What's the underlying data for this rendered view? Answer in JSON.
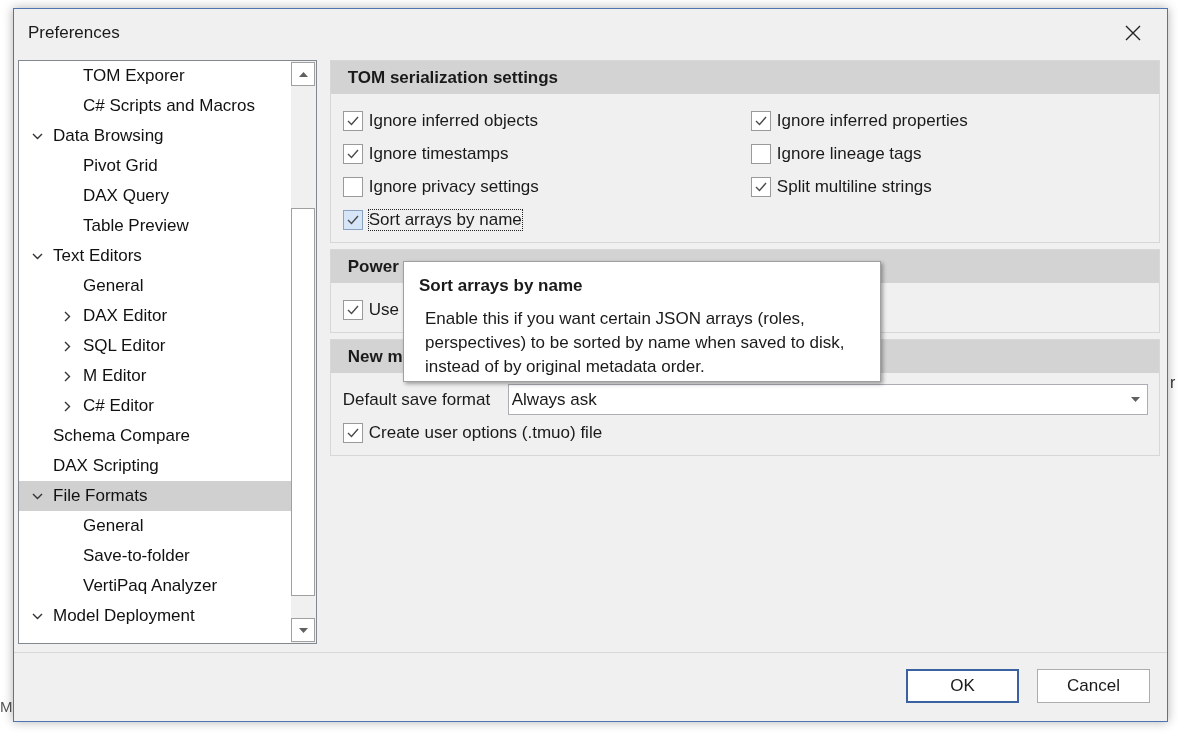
{
  "background": {
    "status_text": "M",
    "side_text": "r"
  },
  "window": {
    "title": "Preferences"
  },
  "tree": {
    "scrolled_children": [
      {
        "label": "TOM Exporer",
        "selected": false
      },
      {
        "label": "C# Scripts and Macros",
        "selected": false
      }
    ],
    "items": [
      {
        "label": "Data Browsing",
        "expanded": true,
        "selected": false,
        "children": [
          {
            "label": "Pivot Grid",
            "selected": false
          },
          {
            "label": "DAX Query",
            "selected": false
          },
          {
            "label": "Table Preview",
            "selected": false
          }
        ]
      },
      {
        "label": "Text Editors",
        "expanded": true,
        "selected": false,
        "children": [
          {
            "label": "General",
            "selected": false
          },
          {
            "label": "DAX Editor",
            "expanded": false,
            "selected": false
          },
          {
            "label": "SQL Editor",
            "expanded": false,
            "selected": false
          },
          {
            "label": "M Editor",
            "expanded": false,
            "selected": false
          },
          {
            "label": "C# Editor",
            "expanded": false,
            "selected": false
          }
        ]
      },
      {
        "label": "Schema Compare",
        "selected": false
      },
      {
        "label": "DAX Scripting",
        "selected": false
      },
      {
        "label": "File Formats",
        "expanded": true,
        "selected": true,
        "children": [
          {
            "label": "General",
            "selected": false
          },
          {
            "label": "Save-to-folder",
            "selected": false
          },
          {
            "label": "VertiPaq Analyzer",
            "selected": false
          }
        ]
      },
      {
        "label": "Model Deployment",
        "expanded": true,
        "selected": false
      }
    ]
  },
  "groups": [
    {
      "kind": "grid",
      "title": "TOM serialization settings",
      "items": [
        {
          "kind": "checkbox",
          "label": "Ignore inferred objects",
          "checked": true,
          "focused": false
        },
        {
          "kind": "checkbox",
          "label": "Ignore inferred properties",
          "checked": true,
          "focused": false
        },
        {
          "kind": "checkbox",
          "label": "Ignore timestamps",
          "checked": true,
          "focused": false
        },
        {
          "kind": "checkbox",
          "label": "Ignore lineage tags",
          "checked": false,
          "focused": false
        },
        {
          "kind": "checkbox",
          "label": "Ignore privacy settings",
          "checked": false,
          "focused": false
        },
        {
          "kind": "checkbox",
          "label": "Split multiline strings",
          "checked": true,
          "focused": false
        },
        {
          "kind": "checkbox",
          "label": "Sort arrays by name",
          "checked": true,
          "focused": true
        }
      ]
    },
    {
      "kind": "list",
      "title": "Power",
      "items": [
        {
          "kind": "checkbox",
          "label": "Use",
          "checked": true,
          "focused": false
        }
      ]
    },
    {
      "kind": "list",
      "title": "New m",
      "items": [
        {
          "kind": "dropdown",
          "label": "Default save format",
          "value": "Always ask"
        },
        {
          "kind": "checkbox",
          "label": "Create user options (.tmuo) file",
          "checked": true,
          "focused": false
        }
      ]
    }
  ],
  "tooltip": {
    "title": "Sort arrays by name",
    "text": "Enable this if you want certain JSON arrays (roles, perspectives) to be sorted by name when saved to disk, instead of by original metadata order."
  },
  "buttons": [
    {
      "label": "OK",
      "default": true
    },
    {
      "label": "Cancel",
      "default": false
    }
  ]
}
